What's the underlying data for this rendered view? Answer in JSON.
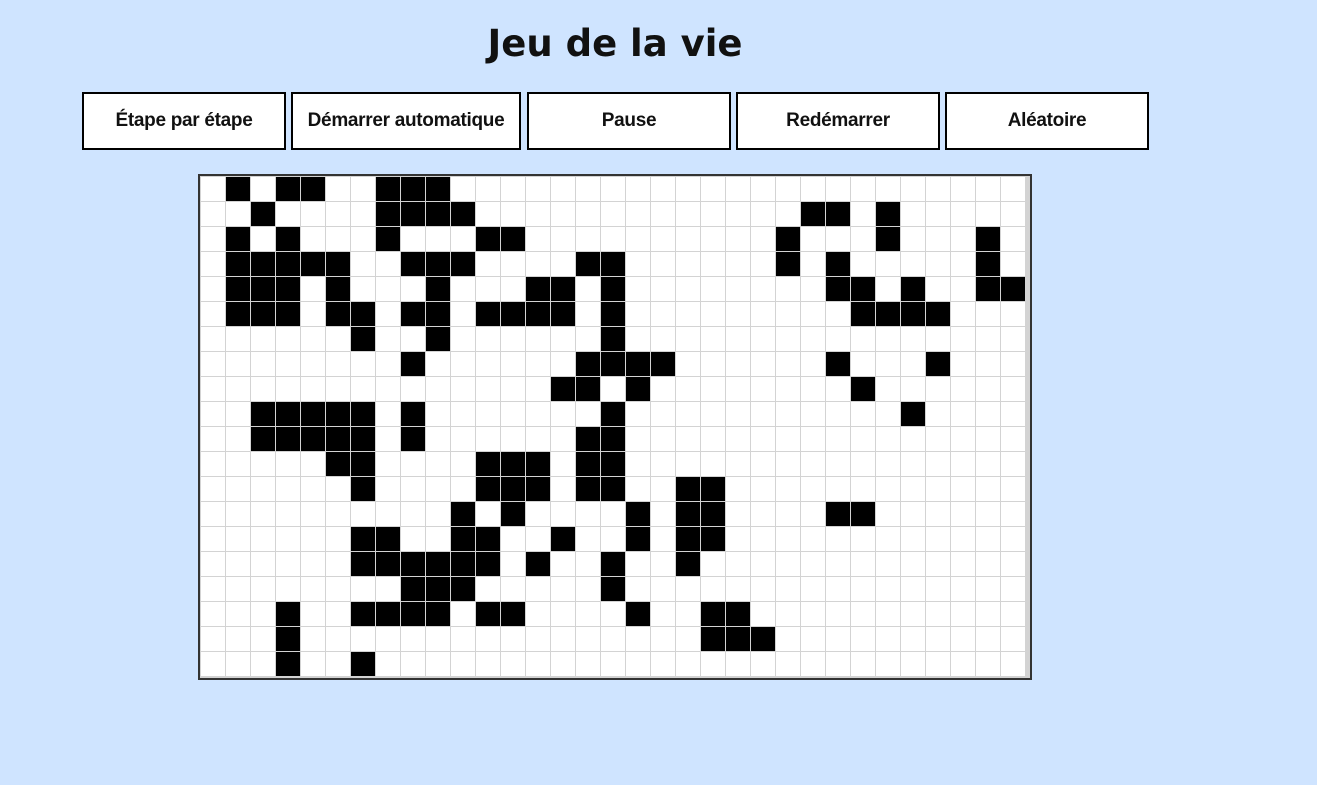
{
  "title": "Jeu de la vie",
  "buttons": {
    "step": "Étape par étape",
    "start": "Démarrer automatique",
    "pause": "Pause",
    "restart": "Redémarrer",
    "random": "Aléatoire"
  },
  "grid": {
    "cols": 33,
    "rows": 20,
    "cells": [
      ".#.##..###.......................",
      "..#....####.............##.#.....",
      ".#.#...#...##..........#...#...#.",
      ".#####..###....##......#.#.....#.",
      ".###.#...#...##.#........##.#..##",
      ".###.##.##.####.#.........####...",
      "......#..#......#................",
      "........#......####......#...#...",
      "..............##.#........#......",
      "..#####.#.......#...........#....",
      "..#####.#......##................",
      ".....##....###.##................",
      "......#....###.##..##............",
      "..........#.#....#.##....##......",
      "......##..##..#..#.##............",
      "......######.#..#..#.............",
      "........###.....#................",
      "...#..####.##....#..##...........",
      "...#................###..........",
      "...#..#.........................."
    ],
    "colors": {
      "alive": "#000000",
      "dead": "#ffffff",
      "gridline": "#d3d3d3"
    }
  },
  "colors": {
    "background": "#cfe4ff"
  }
}
